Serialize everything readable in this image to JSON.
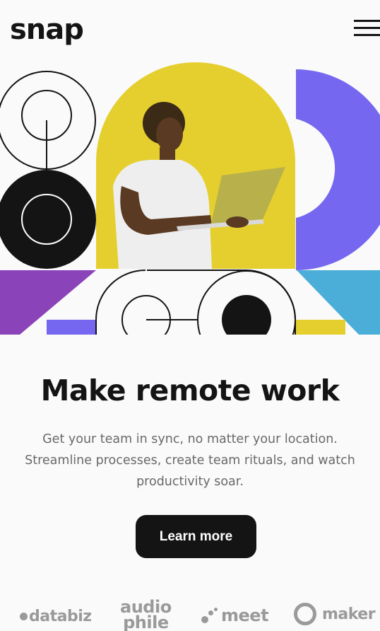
{
  "header": {
    "logo": "snap",
    "menu_icon": "hamburger-menu-icon"
  },
  "hero": {
    "image_alt": "Person holding a laptop against a yellow background",
    "colors": {
      "yellow": "#e5cf2e",
      "purple": "#7567ef",
      "violet": "#8b43b9",
      "blue": "#4aaed9",
      "black": "#141414"
    }
  },
  "main": {
    "headline": "Make remote work",
    "description": "Get your team in sync, no matter your location. Streamline processes, create team rituals, and watch productivity soar.",
    "cta_label": "Learn more"
  },
  "clients": {
    "databiz": "databiz",
    "audiophile_line1": "audio",
    "audiophile_line2": "phile",
    "meet": "meet",
    "maker": "maker"
  }
}
